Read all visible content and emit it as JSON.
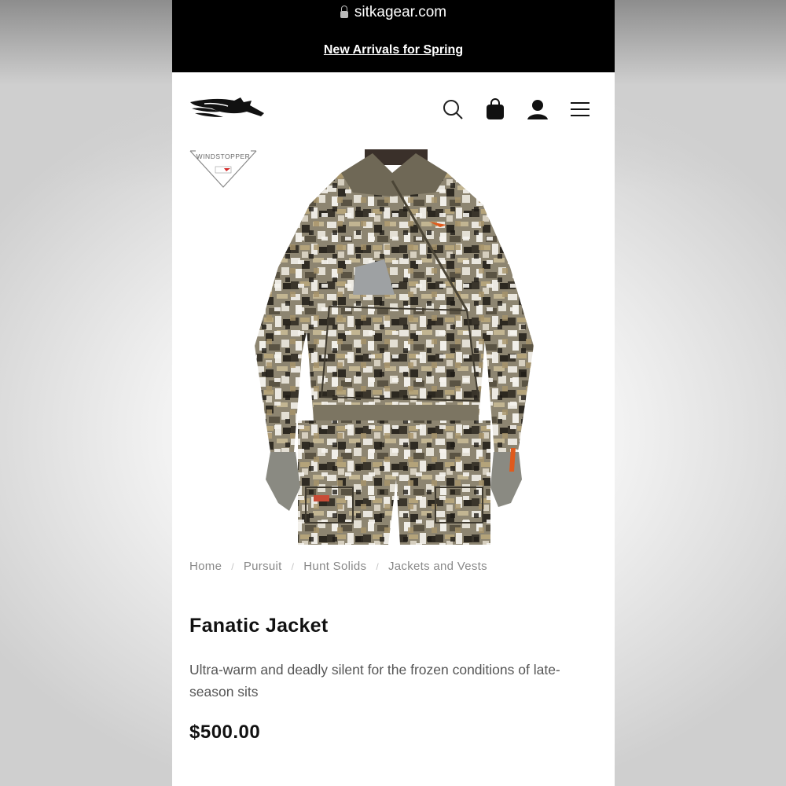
{
  "browser": {
    "url": "sitkagear.com"
  },
  "promo_banner": {
    "text": "New Arrivals for Spring"
  },
  "header": {
    "icons": [
      "search-icon",
      "bag-icon",
      "account-icon",
      "menu-icon"
    ]
  },
  "badge": {
    "text": "WINDSTOPPER"
  },
  "breadcrumb": [
    "Home",
    "Pursuit",
    "Hunt Solids",
    "Jackets and Vests"
  ],
  "product": {
    "title": "Fanatic Jacket",
    "description": "Ultra-warm and deadly silent for the frozen conditions of late-season sits",
    "price": "$500.00"
  },
  "colors": {
    "topbar": "#000000",
    "text": "#111111",
    "muted": "#888888",
    "accent_orange": "#e05a1c"
  }
}
